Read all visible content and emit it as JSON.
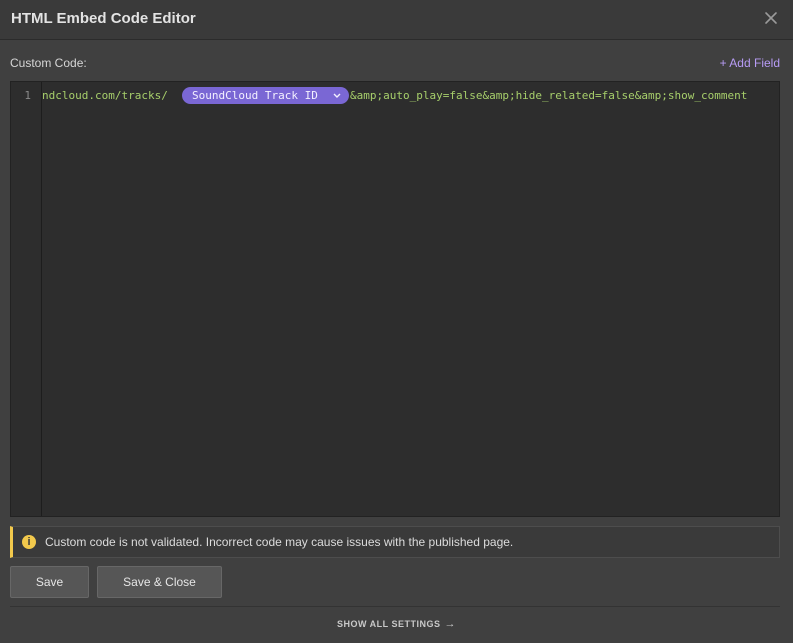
{
  "window": {
    "title": "HTML Embed Code Editor"
  },
  "form": {
    "label": "Custom Code:",
    "add_field": "+ Add Field"
  },
  "editor": {
    "line_number": "1",
    "code_before": "ndcloud.com/tracks/",
    "token_label": "SoundCloud Track ID",
    "code_after": "&amp;auto_play=false&amp;hide_related=false&amp;show_comment"
  },
  "notice": {
    "text": "Custom code is not validated. Incorrect code may cause issues with the published page.",
    "icon": "info-icon",
    "color": "#f2c94c"
  },
  "buttons": {
    "save": "Save",
    "save_close": "Save & Close"
  },
  "footer": {
    "show_all": "SHOW ALL SETTINGS"
  },
  "colors": {
    "accent": "#7a67d4",
    "link": "#b79cf5",
    "code": "#a7cf6b"
  }
}
